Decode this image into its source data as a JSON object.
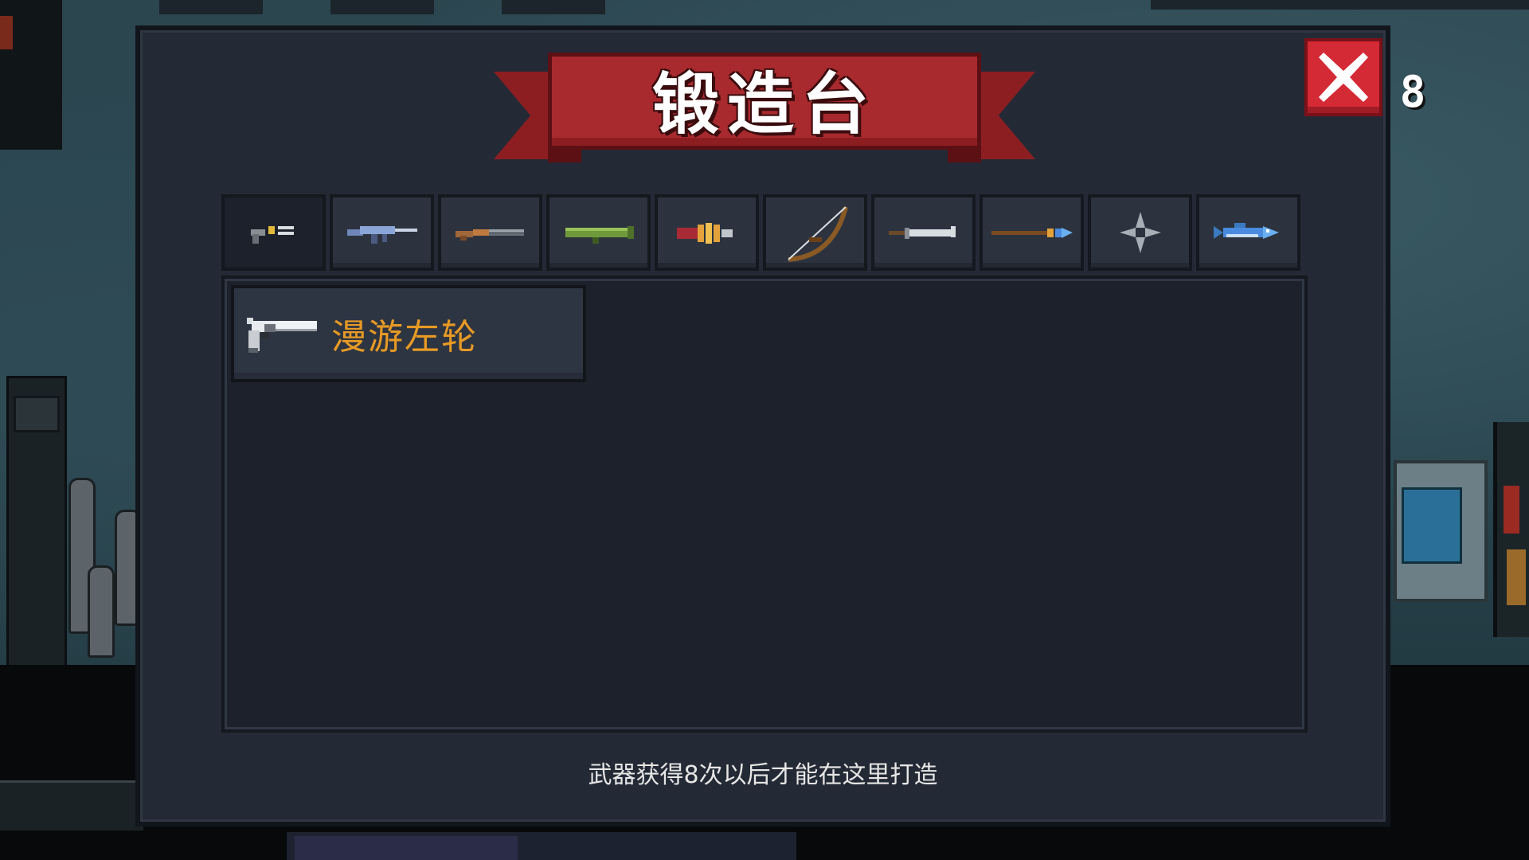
{
  "forge": {
    "title": "锻造台",
    "counter": "8",
    "hint": "武器获得8次以后才能在这里打造"
  },
  "category_tabs": [
    {
      "name": "pistol-icon",
      "active": true
    },
    {
      "name": "rifle-icon",
      "active": false
    },
    {
      "name": "shotgun-icon",
      "active": false
    },
    {
      "name": "launcher-icon",
      "active": false
    },
    {
      "name": "special-gun-icon",
      "active": false
    },
    {
      "name": "bow-icon",
      "active": false
    },
    {
      "name": "sword-icon",
      "active": false
    },
    {
      "name": "spear-icon",
      "active": false
    },
    {
      "name": "throwing-star-icon",
      "active": false
    },
    {
      "name": "fish-icon",
      "active": false
    }
  ],
  "items": [
    {
      "label": "漫游左轮",
      "icon": "revolver-icon"
    }
  ],
  "colors": {
    "banner": "#a82a2e",
    "close": "#d42a35",
    "item_text": "#e89a24",
    "panel": "#242a35"
  }
}
